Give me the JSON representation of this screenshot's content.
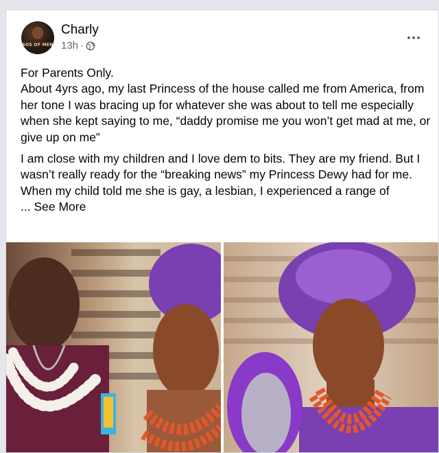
{
  "post": {
    "author": "Charly",
    "avatar_caption": "SOS OF MEN",
    "time": "13h",
    "separator": "·",
    "paragraphs": [
      "For Parents Only.",
      "About 4yrs ago, my last Princess of the house called me from America, from  her tone I was bracing up for whatever she was about to tell me especially when she kept saying to me, “daddy promise me you won’t get mad at me, or give up on me”",
      "I am close with my children and I love dem to bits. They are my friend. But I wasn’t really ready for the “breaking news” my Princess Dewy had for me.",
      "When my child told me she is gay, a lesbian, I experienced a range of"
    ],
    "ellipsis": "... ",
    "see_more": "See More"
  },
  "icons": {
    "privacy": "globe-icon",
    "menu": "more-options-icon"
  },
  "colors": {
    "text_primary": "#050505",
    "text_secondary": "#65676b",
    "gele_purple": "#7a3fb0",
    "coral_beads": "#e2572b"
  }
}
